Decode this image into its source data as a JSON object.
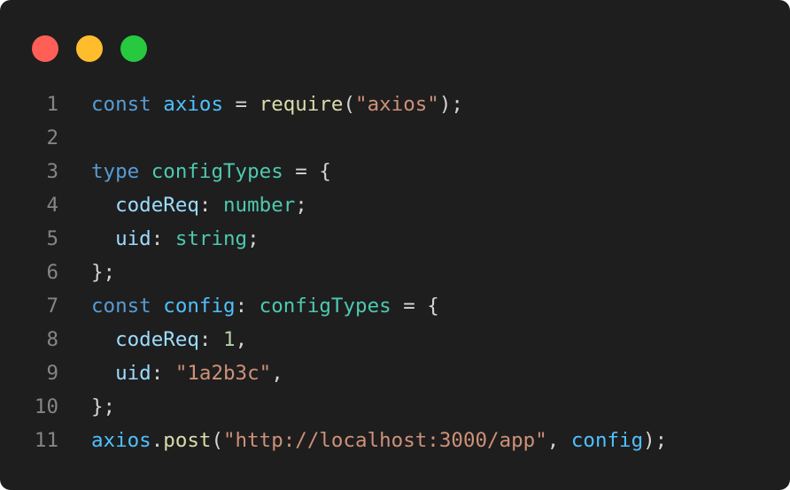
{
  "window": {
    "controls": [
      {
        "name": "close",
        "color": "#ff5f56"
      },
      {
        "name": "minimize",
        "color": "#ffbd2e"
      },
      {
        "name": "maximize",
        "color": "#27c93f"
      }
    ]
  },
  "theme": {
    "background": "#1e1e1e",
    "line_number": "#858585",
    "keyword": "#569cd6",
    "variable": "#4fc1ff",
    "function": "#dcdcaa",
    "string": "#ce9178",
    "type": "#4ec9b0",
    "property": "#9cdcfe",
    "number": "#b5cea8",
    "punctuation": "#d4d4d4"
  },
  "code": {
    "lines": [
      {
        "number": "1",
        "tokens": [
          {
            "t": "const",
            "c": "keyword"
          },
          {
            "t": " ",
            "c": "punctuation"
          },
          {
            "t": "axios",
            "c": "variable"
          },
          {
            "t": " = ",
            "c": "punctuation"
          },
          {
            "t": "require",
            "c": "function"
          },
          {
            "t": "(",
            "c": "punctuation"
          },
          {
            "t": "\"axios\"",
            "c": "string"
          },
          {
            "t": ");",
            "c": "punctuation"
          }
        ]
      },
      {
        "number": "2",
        "tokens": []
      },
      {
        "number": "3",
        "tokens": [
          {
            "t": "type",
            "c": "keyword"
          },
          {
            "t": " ",
            "c": "punctuation"
          },
          {
            "t": "configTypes",
            "c": "type"
          },
          {
            "t": " = {",
            "c": "punctuation"
          }
        ]
      },
      {
        "number": "4",
        "tokens": [
          {
            "t": "  ",
            "c": "punctuation"
          },
          {
            "t": "codeReq",
            "c": "property"
          },
          {
            "t": ": ",
            "c": "punctuation"
          },
          {
            "t": "number",
            "c": "type"
          },
          {
            "t": ";",
            "c": "punctuation"
          }
        ]
      },
      {
        "number": "5",
        "tokens": [
          {
            "t": "  ",
            "c": "punctuation"
          },
          {
            "t": "uid",
            "c": "property"
          },
          {
            "t": ": ",
            "c": "punctuation"
          },
          {
            "t": "string",
            "c": "type"
          },
          {
            "t": ";",
            "c": "punctuation"
          }
        ]
      },
      {
        "number": "6",
        "tokens": [
          {
            "t": "};",
            "c": "punctuation"
          }
        ]
      },
      {
        "number": "7",
        "tokens": [
          {
            "t": "const",
            "c": "keyword"
          },
          {
            "t": " ",
            "c": "punctuation"
          },
          {
            "t": "config",
            "c": "variable"
          },
          {
            "t": ": ",
            "c": "punctuation"
          },
          {
            "t": "configTypes",
            "c": "type"
          },
          {
            "t": " = {",
            "c": "punctuation"
          }
        ]
      },
      {
        "number": "8",
        "tokens": [
          {
            "t": "  ",
            "c": "punctuation"
          },
          {
            "t": "codeReq",
            "c": "property"
          },
          {
            "t": ": ",
            "c": "punctuation"
          },
          {
            "t": "1",
            "c": "number"
          },
          {
            "t": ",",
            "c": "punctuation"
          }
        ]
      },
      {
        "number": "9",
        "tokens": [
          {
            "t": "  ",
            "c": "punctuation"
          },
          {
            "t": "uid",
            "c": "property"
          },
          {
            "t": ": ",
            "c": "punctuation"
          },
          {
            "t": "\"1a2b3c\"",
            "c": "string"
          },
          {
            "t": ",",
            "c": "punctuation"
          }
        ]
      },
      {
        "number": "10",
        "tokens": [
          {
            "t": "};",
            "c": "punctuation"
          }
        ]
      },
      {
        "number": "11",
        "tokens": [
          {
            "t": "axios",
            "c": "variable"
          },
          {
            "t": ".",
            "c": "punctuation"
          },
          {
            "t": "post",
            "c": "function"
          },
          {
            "t": "(",
            "c": "punctuation"
          },
          {
            "t": "\"http://localhost:3000/app\"",
            "c": "string"
          },
          {
            "t": ", ",
            "c": "punctuation"
          },
          {
            "t": "config",
            "c": "variable"
          },
          {
            "t": ");",
            "c": "punctuation"
          }
        ]
      }
    ]
  }
}
